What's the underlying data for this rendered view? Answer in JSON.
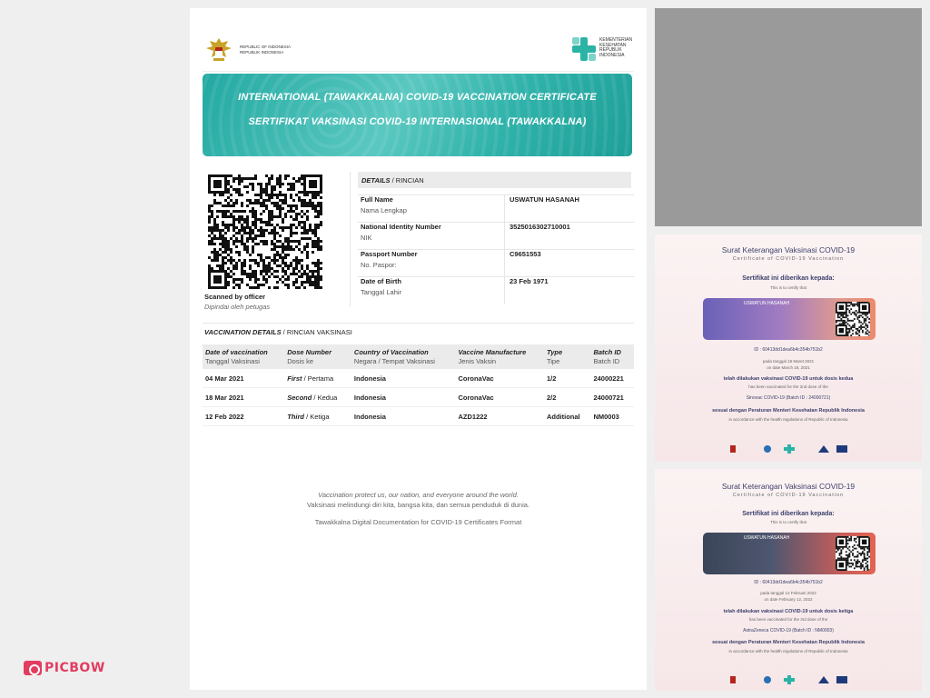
{
  "main": {
    "ri_line1": "REPUBLIC OF INDONESIA",
    "ri_line2": "REPUBLIK INDONESIA",
    "kemenkes": [
      "KEMENTERIAN",
      "KESEHATAN",
      "REPUBLIK",
      "INDONESIA"
    ],
    "banner_title_en": "INTERNATIONAL (TAWAKKALNA) COVID-19 VACCINATION CERTIFICATE",
    "banner_title_id": "SERTIFIKAT VAKSINASI COVID-19 INTERNASIONAL (TAWAKKALNA)",
    "scanned_en": "Scanned by officer",
    "scanned_id": "Dipindai oleh petugas",
    "details_head_en": "DETAILS",
    "details_head_id": " / RINCIAN",
    "details": [
      {
        "en": "Full Name",
        "id": "Nama Lengkap",
        "value": "USWATUN HASANAH"
      },
      {
        "en": "National Identity Number",
        "id": "NIK",
        "value": "3525016302710001"
      },
      {
        "en": "Passport Number",
        "id": "No. Paspor:",
        "value": "C9651553"
      },
      {
        "en": "Date of Birth",
        "id": "Tanggal Lahir",
        "value": "23 Feb 1971"
      }
    ],
    "vax_head_en": "VACCINATION DETAILS",
    "vax_head_id": " / RINCIAN VAKSINASI",
    "vax_columns": [
      {
        "en": "Date of vaccination",
        "id": "Tanggal Vaksinasi"
      },
      {
        "en": "Dose Number",
        "id": "Dosis ke"
      },
      {
        "en": "Country of Vaccination",
        "id": "Negara / Tempat Vaksinasi"
      },
      {
        "en": "Vaccine Manufacture",
        "id": "Jenis Vaksin"
      },
      {
        "en": "Type",
        "id": "Tipe"
      },
      {
        "en": "Batch ID",
        "id": "Batch ID"
      }
    ],
    "vax_rows": [
      {
        "date": "04 Mar 2021",
        "dose_en": "First",
        "dose_id": " / Pertama",
        "country": "Indonesia",
        "vaccine": "CoronaVac",
        "type": "1/2",
        "batch": "24000221"
      },
      {
        "date": "18 Mar 2021",
        "dose_en": "Second",
        "dose_id": " / Kedua",
        "country": "Indonesia",
        "vaccine": "CoronaVac",
        "type": "2/2",
        "batch": "24000721"
      },
      {
        "date": "12 Feb 2022",
        "dose_en": "Third",
        "dose_id": " / Ketiga",
        "country": "Indonesia",
        "vaccine": "AZD1222",
        "type": "Additional",
        "batch": "NM0003"
      }
    ],
    "footer_1": "Vaccination protect us, our nation, and everyone around the world.",
    "footer_2": "Vaksinasi melindungi diri kita, bangsa kita, dan semua penduduk di dunia.",
    "footer_3": "Tawakkalna Digital Documentation for COVID-19 Certificates Format"
  },
  "cert1": {
    "title": "Surat Keterangan Vaksinasi COVID-19",
    "subtitle": "Certificate of COVID-19 Vaccination",
    "given_to": "Sertifikat ini diberikan kepada:",
    "given_to_en": "This is to certify that",
    "name": "USWATUN HASANAH",
    "id_line": "ID : 60413dd1dea6b4c354b751b2",
    "date_id": "pada tanggal 18 Maret 2021",
    "date_en": "on date March 18, 2021",
    "done": "telah dilakukan vaksinasi COVID-19 untuk dosis kedua",
    "done_en": "has been vaccinated for the 2nd dose of the",
    "vaccine": "Sinovac COVID-19 (Batch ID : 24000721)",
    "law": "sesuai dengan Peraturan Menteri Kesehatan Republik Indonesia",
    "law_en": "in accordance with the health regulations of Republic of Indonesia"
  },
  "cert2": {
    "title": "Surat Keterangan Vaksinasi COVID-19",
    "subtitle": "Certificate of COVID-19 Vaccination",
    "given_to": "Sertifikat ini diberikan kepada:",
    "given_to_en": "This is to certify that",
    "name": "USWATUN HASANAH",
    "id_line": "ID : 60413dd1dea6b4c354b751b2",
    "date_id": "pada tanggal 12 Februari 2022",
    "date_en": "on date February 12, 2022",
    "done": "telah dilakukan vaksinasi COVID-19 untuk dosis ketiga",
    "done_en": "has been vaccinated for the 3rd dose of the",
    "vaccine": "AstraZeneca COVID-19 (Batch ID : NM0003)",
    "law": "sesuai dengan Peraturan Menteri Kesehatan Republik Indonesia",
    "law_en": "in accordance with the health regulations of Republic of Indonesia"
  },
  "watermark": "PICBOW",
  "colors": {
    "teal": "#22a9a2",
    "brand_pink": "#e23d5f",
    "cert_navy": "#3b3f6b"
  }
}
